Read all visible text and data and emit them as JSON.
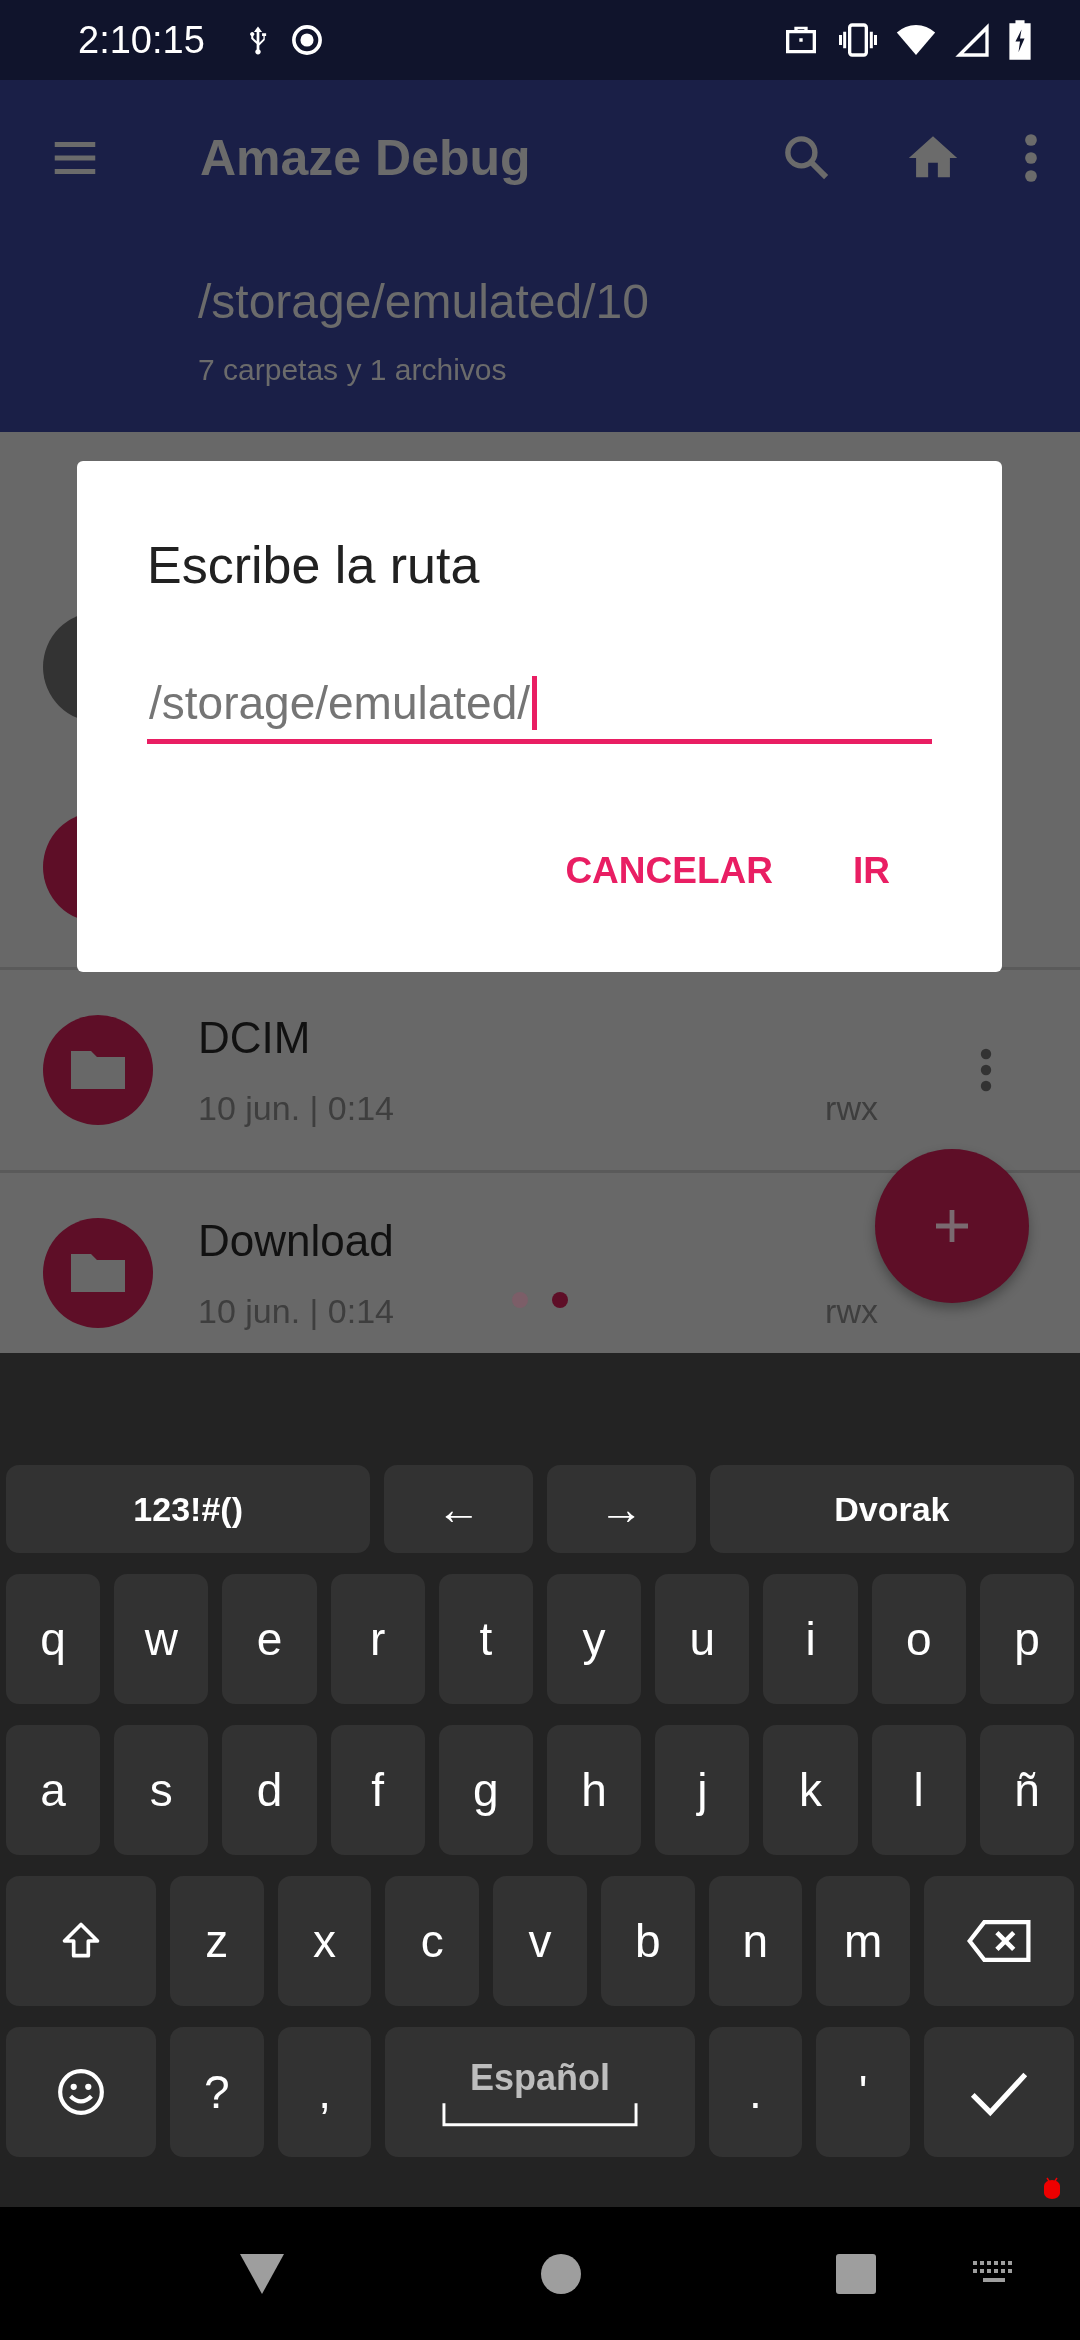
{
  "status_bar": {
    "time": "2:10:15"
  },
  "toolbar": {
    "title": "Amaze Debug",
    "path": "/storage/emulated/10",
    "summary": "7 carpetas y 1 archivos"
  },
  "files": [
    {
      "name": "DCIM",
      "date": "10 jun. | 0:14",
      "permissions": "rwx",
      "menu_icon": true
    },
    {
      "name": "Download",
      "date": "10 jun. | 0:14",
      "permissions": "rwx",
      "menu_icon": false
    }
  ],
  "page_dots": [
    {
      "selected": false
    },
    {
      "selected": true
    }
  ],
  "dialog": {
    "title": "Escribe la ruta",
    "field": {
      "value": "/storage/emulated/"
    },
    "buttons": [
      "CANCELAR",
      "IR"
    ]
  },
  "keyboard": {
    "top_row": [
      {
        "kind": "mode",
        "label": "123!#()"
      },
      {
        "kind": "arrow",
        "label": "←"
      },
      {
        "kind": "arrow",
        "label": "→"
      },
      {
        "kind": "mode",
        "label": "Dvorak"
      }
    ],
    "rows": [
      {
        "keys": [
          {
            "kind": "char",
            "label": "q"
          },
          {
            "kind": "char",
            "label": "w"
          },
          {
            "kind": "char",
            "label": "e"
          },
          {
            "kind": "char",
            "label": "r"
          },
          {
            "kind": "char",
            "label": "t"
          },
          {
            "kind": "char",
            "label": "y"
          },
          {
            "kind": "char",
            "label": "u"
          },
          {
            "kind": "char",
            "label": "i"
          },
          {
            "kind": "char",
            "label": "o"
          },
          {
            "kind": "char",
            "label": "p"
          }
        ]
      },
      {
        "keys": [
          {
            "kind": "char",
            "label": "a"
          },
          {
            "kind": "char",
            "label": "s"
          },
          {
            "kind": "char",
            "label": "d"
          },
          {
            "kind": "char",
            "label": "f"
          },
          {
            "kind": "char",
            "label": "g"
          },
          {
            "kind": "char",
            "label": "h"
          },
          {
            "kind": "char",
            "label": "j"
          },
          {
            "kind": "char",
            "label": "k"
          },
          {
            "kind": "char",
            "label": "l"
          },
          {
            "kind": "char",
            "label": "ñ"
          }
        ]
      },
      {
        "keys": [
          {
            "kind": "shift"
          },
          {
            "kind": "char",
            "label": "z"
          },
          {
            "kind": "char",
            "label": "x"
          },
          {
            "kind": "char",
            "label": "c"
          },
          {
            "kind": "char",
            "label": "v"
          },
          {
            "kind": "char",
            "label": "b"
          },
          {
            "kind": "char",
            "label": "n"
          },
          {
            "kind": "char",
            "label": "m"
          },
          {
            "kind": "backspace"
          }
        ]
      },
      {
        "keys": [
          {
            "kind": "emoji"
          },
          {
            "kind": "char",
            "label": "?"
          },
          {
            "kind": "char",
            "label": ","
          },
          {
            "kind": "space",
            "label": "Español"
          },
          {
            "kind": "char",
            "label": "."
          },
          {
            "kind": "char",
            "label": "'"
          },
          {
            "kind": "enter"
          }
        ]
      }
    ]
  }
}
